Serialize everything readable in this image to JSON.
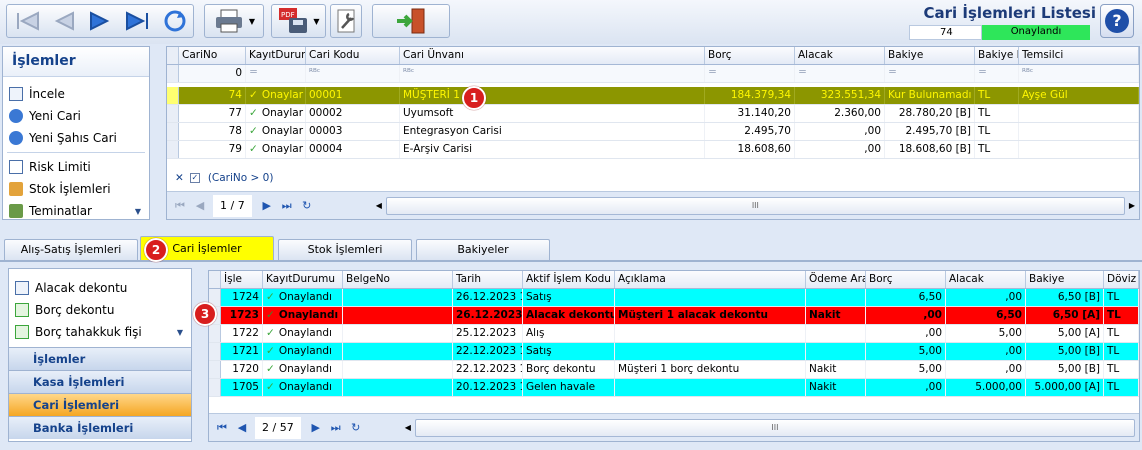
{
  "header": {
    "title": "Cari İşlemleri Listesi",
    "count": "74",
    "status": "Onaylandı"
  },
  "left_menu": {
    "title": "İşlemler",
    "items": [
      "İncele",
      "Yeni Cari",
      "Yeni Şahıs Cari",
      "Risk Limiti",
      "Stok İşlemleri",
      "Teminatlar"
    ]
  },
  "top_grid": {
    "columns": [
      "CariNo",
      "KayıtDurumu",
      "Cari Kodu",
      "Cari Ünvanı",
      "Borç",
      "Alacak",
      "Bakiye",
      "Bakiye D",
      "Temsilci"
    ],
    "filter": {
      "carino": "0"
    },
    "rows": [
      {
        "no": "74",
        "durum": "Onaylar",
        "kod": "00001",
        "unvan": "MÜŞTERİ 1",
        "borc": "184.379,34",
        "alacak": "323.551,34",
        "bakiye": "Kur Bulunamadı",
        "bd": "TL",
        "temsilci": "Ayşe Gül"
      },
      {
        "no": "77",
        "durum": "Onaylar",
        "kod": "00002",
        "unvan": "Uyumsoft",
        "borc": "31.140,20",
        "alacak": "2.360,00",
        "bakiye": "28.780,20 [B]",
        "bd": "TL",
        "temsilci": ""
      },
      {
        "no": "78",
        "durum": "Onaylar",
        "kod": "00003",
        "unvan": "Entegrasyon Carisi",
        "borc": "2.495,70",
        "alacak": ",00",
        "bakiye": "2.495,70 [B]",
        "bd": "TL",
        "temsilci": ""
      },
      {
        "no": "79",
        "durum": "Onaylar",
        "kod": "00004",
        "unvan": "E-Arşiv Carisi",
        "borc": "18.608,60",
        "alacak": ",00",
        "bakiye": "18.608,60 [B]",
        "bd": "TL",
        "temsilci": ""
      }
    ],
    "filter_text": "(CariNo > 0)",
    "page": "1 / 7"
  },
  "tabs": [
    "Alış-Satış İşlemleri",
    "Cari İşlemler",
    "Stok İşlemleri",
    "Bakiyeler"
  ],
  "sub_menu": {
    "items": [
      "Alacak dekontu",
      "Borç dekontu",
      "Borç tahakkuk fişi"
    ],
    "sections": [
      "İşlemler",
      "Kasa İşlemleri",
      "Cari İşlemleri",
      "Banka İşlemleri"
    ]
  },
  "bottom_grid": {
    "columns": [
      "İşle",
      "KayıtDurumu",
      "BelgeNo",
      "Tarih",
      "Aktif İşlem Kodu",
      "Açıklama",
      "Ödeme Araı",
      "Borç",
      "Alacak",
      "Bakiye",
      "Döviz"
    ],
    "rows": [
      {
        "isle": "1724",
        "durum": "Onaylandı",
        "belge": "",
        "tarih": "26.12.2023 1",
        "kod": "Satış",
        "aciklama": "",
        "odeme": "",
        "borc": "6,50",
        "alacak": ",00",
        "bakiye": "6,50 [B]",
        "doviz": "TL",
        "style": "cyan"
      },
      {
        "isle": "1723",
        "durum": "Onaylandı",
        "belge": "",
        "tarih": "26.12.2023",
        "kod": "Alacak dekontu",
        "aciklama": "Müşteri 1 alacak dekontu",
        "odeme": "Nakit",
        "borc": ",00",
        "alacak": "6,50",
        "bakiye": "6,50 [A]",
        "doviz": "TL",
        "style": "red"
      },
      {
        "isle": "1722",
        "durum": "Onaylandı",
        "belge": "",
        "tarih": "25.12.2023",
        "kod": "Alış",
        "aciklama": "",
        "odeme": "",
        "borc": ",00",
        "alacak": "5,00",
        "bakiye": "5,00 [A]",
        "doviz": "TL",
        "style": ""
      },
      {
        "isle": "1721",
        "durum": "Onaylandı",
        "belge": "",
        "tarih": "22.12.2023 1",
        "kod": "Satış",
        "aciklama": "",
        "odeme": "",
        "borc": "5,00",
        "alacak": ",00",
        "bakiye": "5,00 [B]",
        "doviz": "TL",
        "style": "cyan"
      },
      {
        "isle": "1720",
        "durum": "Onaylandı",
        "belge": "",
        "tarih": "22.12.2023 1",
        "kod": "Borç dekontu",
        "aciklama": "Müşteri 1 borç dekontu",
        "odeme": "Nakit",
        "borc": "5,00",
        "alacak": ",00",
        "bakiye": "5,00 [B]",
        "doviz": "TL",
        "style": ""
      },
      {
        "isle": "1705",
        "durum": "Onaylandı",
        "belge": "",
        "tarih": "20.12.2023 1",
        "kod": "Gelen havale",
        "aciklama": "",
        "odeme": "Nakit",
        "borc": ",00",
        "alacak": "5.000,00",
        "bakiye": "5.000,00 [A]",
        "doviz": "TL",
        "style": "cyan"
      }
    ],
    "page": "2 / 57"
  },
  "badges": [
    "1",
    "2",
    "3"
  ],
  "scroll_grip": "III"
}
